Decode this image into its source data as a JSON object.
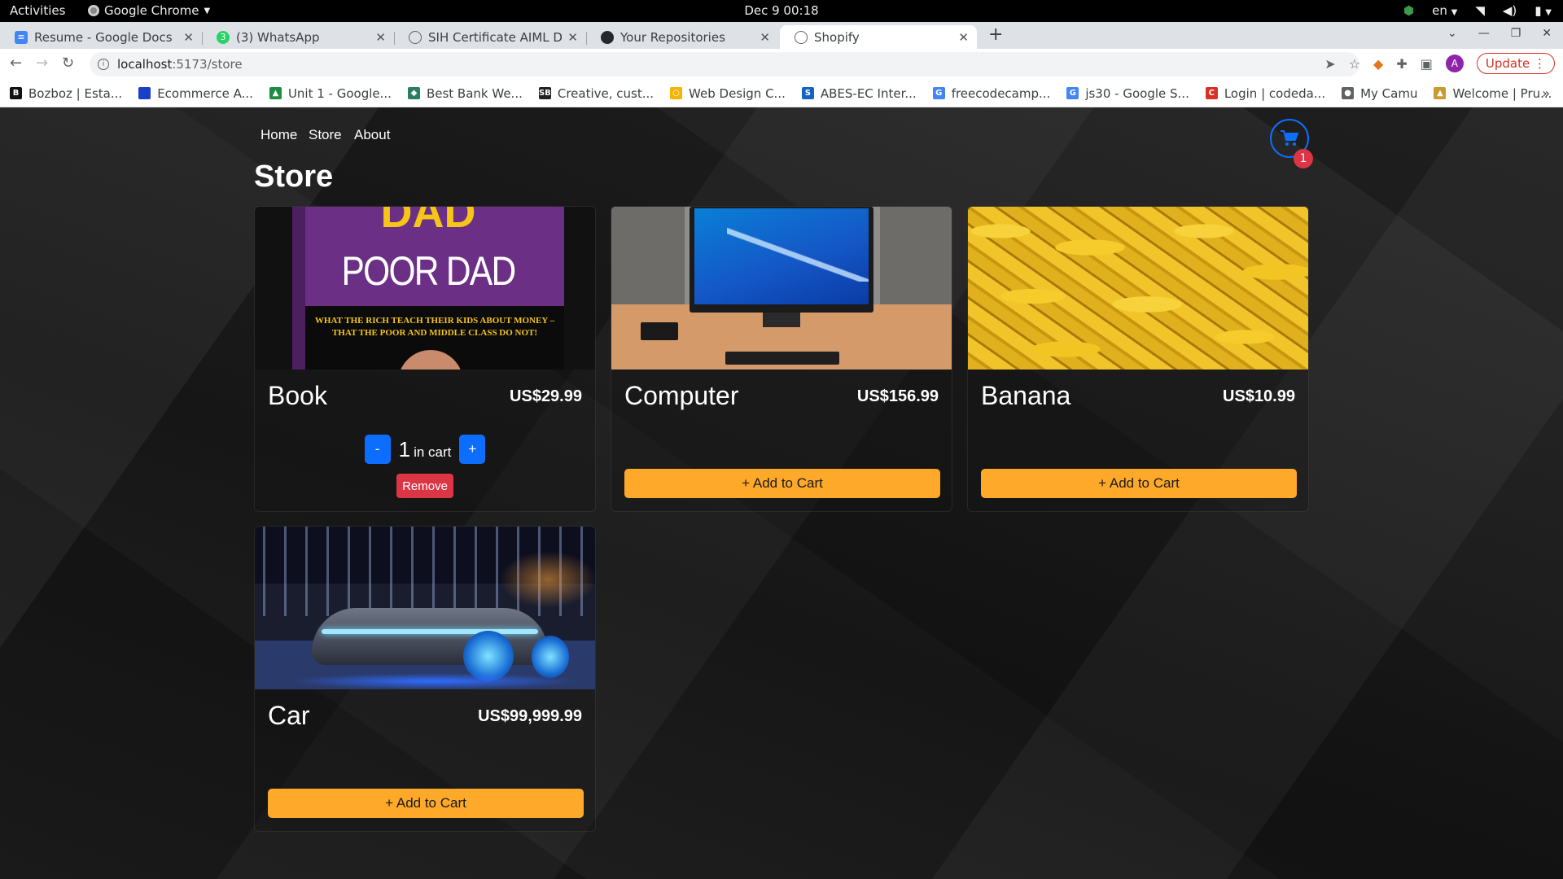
{
  "os_bar": {
    "activities": "Activities",
    "app_name": "Google Chrome",
    "clock": "Dec 9  00:18",
    "lang": "en"
  },
  "tabs": [
    {
      "title": "Resume - Google Docs",
      "icon": "docs-icon",
      "active": false
    },
    {
      "title": "(3) WhatsApp",
      "icon": "whatsapp-icon",
      "active": false
    },
    {
      "title": "SIH Certificate AIML Dept",
      "icon": "globe-icon",
      "active": false
    },
    {
      "title": "Your Repositories",
      "icon": "github-icon",
      "active": false
    },
    {
      "title": "Shopify",
      "icon": "globe-icon",
      "active": true
    }
  ],
  "address_bar": {
    "host": "localhost",
    "path": ":5173/store",
    "update_label": "Update",
    "profile_initial": "A"
  },
  "bookmarks": [
    {
      "label": "Bozboz | Esta...",
      "icon_letter": "B",
      "color": "#111111"
    },
    {
      "label": "Ecommerce A...",
      "icon_letter": "",
      "color": "#1a3fc7"
    },
    {
      "label": "Unit 1 - Google...",
      "icon_letter": "▲",
      "color": "#1e8e3e"
    },
    {
      "label": "Best Bank We...",
      "icon_letter": "◆",
      "color": "#2a7f62"
    },
    {
      "label": "Creative, cust...",
      "icon_letter": "SB",
      "color": "#222222"
    },
    {
      "label": "Web Design C...",
      "icon_letter": "○",
      "color": "#f4b400"
    },
    {
      "label": "ABES-EC Inter...",
      "icon_letter": "S",
      "color": "#1565c0"
    },
    {
      "label": "freecodecamp...",
      "icon_letter": "G",
      "color": "#4285f4"
    },
    {
      "label": "js30 - Google S...",
      "icon_letter": "G",
      "color": "#4285f4"
    },
    {
      "label": "Login | codeda...",
      "icon_letter": "C",
      "color": "#d93025"
    },
    {
      "label": "My Camu",
      "icon_letter": "●",
      "color": "#5f6368"
    },
    {
      "label": "Welcome | Pru...",
      "icon_letter": "▲",
      "color": "#c99a2e"
    }
  ],
  "site": {
    "nav": {
      "home": "Home",
      "store": "Store",
      "about": "About"
    },
    "cart_count": "1",
    "page_title": "Store"
  },
  "products": [
    {
      "name": "Book",
      "price": "US$29.99",
      "quantity": "1",
      "qty_suffix": "in cart",
      "remove_label": "Remove",
      "minus": "-",
      "plus": "+",
      "book_cover": {
        "title_top": "DAD",
        "title_main": "POOR DAD",
        "tagline_1": "WHAT THE RICH TEACH THEIR KIDS ABOUT MONEY –",
        "tagline_2": "THAT THE POOR AND MIDDLE CLASS DO NOT!"
      }
    },
    {
      "name": "Computer",
      "price": "US$156.99",
      "add_label": "+ Add to Cart"
    },
    {
      "name": "Banana",
      "price": "US$10.99",
      "add_label": "+ Add to Cart"
    },
    {
      "name": "Car",
      "price": "US$99,999.99",
      "add_label": "+ Add to Cart"
    }
  ],
  "colors": {
    "accent_blue": "#0d6efd",
    "add_to_cart": "#ffa92b",
    "danger": "#dc3545"
  }
}
